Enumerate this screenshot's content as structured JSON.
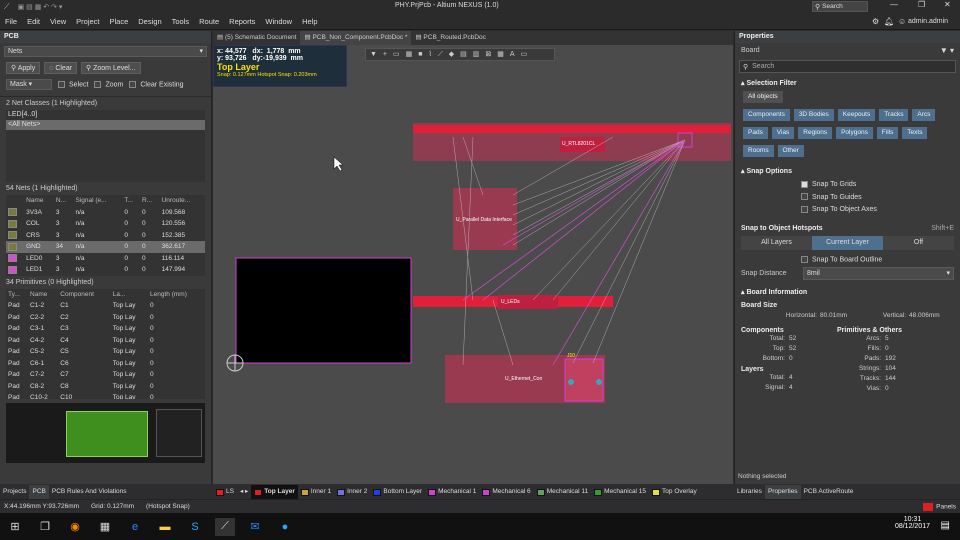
{
  "titlebar": {
    "title": "PHY.PrjPcb - Altium NEXUS (1.0)",
    "search": "Search",
    "user": "admin.admin"
  },
  "menu": [
    "File",
    "Edit",
    "View",
    "Project",
    "Place",
    "Design",
    "Tools",
    "Route",
    "Reports",
    "Window",
    "Help"
  ],
  "left": {
    "panel_title": "PCB",
    "mode_select": "Nets",
    "apply": "Apply",
    "clear": "Clear",
    "zoom_level": "Zoom Level...",
    "mask": "Mask",
    "select": "Select",
    "zoom": "Zoom",
    "clear_existing": "Clear Existing",
    "net_classes_header": "2 Net Classes (1 Highlighted)",
    "net_classes": [
      "LED[4..0]",
      "<All Nets>"
    ],
    "nets_header": "54 Nets (1 Highlighted)",
    "nets_cols": [
      "Name",
      "N...",
      "Signal (e...",
      "T...",
      "R...",
      "Unroute..."
    ],
    "nets": [
      {
        "color": "#7a7a3a",
        "name": "3V3A",
        "n": "3",
        "sig": "n/a",
        "t": "0",
        "r": "0",
        "un": "109.568"
      },
      {
        "color": "#7a7a3a",
        "name": "COL",
        "n": "3",
        "sig": "n/a",
        "t": "0",
        "r": "0",
        "un": "120.556"
      },
      {
        "color": "#7a7a3a",
        "name": "CRS",
        "n": "3",
        "sig": "n/a",
        "t": "0",
        "r": "0",
        "un": "152.385"
      },
      {
        "color": "#7a7a3a",
        "name": "GND",
        "n": "34",
        "sig": "n/a",
        "t": "0",
        "r": "0",
        "un": "362.617"
      },
      {
        "color": "#d050d0",
        "name": "LED0",
        "n": "3",
        "sig": "n/a",
        "t": "0",
        "r": "0",
        "un": "116.114"
      },
      {
        "color": "#d050d0",
        "name": "LED1",
        "n": "3",
        "sig": "n/a",
        "t": "0",
        "r": "0",
        "un": "147.994"
      }
    ],
    "prims_header": "34 Primitives (0 Highlighted)",
    "prims_cols": [
      "Ty...",
      "Name",
      "Component",
      "La...",
      "Length (mm)"
    ],
    "prims": [
      {
        "t": "Pad",
        "n": "C1-2",
        "c": "C1",
        "l": "Top Lay",
        "len": "0"
      },
      {
        "t": "Pad",
        "n": "C2-2",
        "c": "C2",
        "l": "Top Lay",
        "len": "0"
      },
      {
        "t": "Pad",
        "n": "C3-1",
        "c": "C3",
        "l": "Top Lay",
        "len": "0"
      },
      {
        "t": "Pad",
        "n": "C4-2",
        "c": "C4",
        "l": "Top Lay",
        "len": "0"
      },
      {
        "t": "Pad",
        "n": "C5-2",
        "c": "C5",
        "l": "Top Lay",
        "len": "0"
      },
      {
        "t": "Pad",
        "n": "C6-1",
        "c": "C6",
        "l": "Top Lay",
        "len": "0"
      },
      {
        "t": "Pad",
        "n": "C7-2",
        "c": "C7",
        "l": "Top Lay",
        "len": "0"
      },
      {
        "t": "Pad",
        "n": "C8-2",
        "c": "C8",
        "l": "Top Lay",
        "len": "0"
      },
      {
        "t": "Pad",
        "n": "C10-2",
        "c": "C10",
        "l": "Top Lay",
        "len": "0"
      }
    ],
    "bottom_tabs": [
      "Projects",
      "PCB",
      "PCB Rules And Violations"
    ]
  },
  "doctabs": [
    "(5) Schematic Document",
    "PCB_Non_Component.PcbDoc *",
    "PCB_Routed.PcbDoc"
  ],
  "hud": {
    "line1": "x: 44,577   dx:  1,778  mm",
    "line2": "y: 93,726   dy:-19,939  mm",
    "layer": "Top Layer",
    "snap": "Snap: 0.127mm Hotspot Snap: 0.203mm"
  },
  "pcb_labels": {
    "u1": "U_RTL8201CL",
    "u2": "U_Parallel Data Interface",
    "u3": "U_LEDs",
    "u4": "U_Ethernet_Con",
    "u5": "J10"
  },
  "right": {
    "title": "Properties",
    "board": "Board",
    "search": "Search",
    "sel_filter": "Selection Filter",
    "filter_all": "All objects",
    "filters": [
      "Components",
      "3D Bodies",
      "Keepouts",
      "Tracks",
      "Arcs",
      "Pads",
      "Vias",
      "Regions",
      "Polygons",
      "Fills",
      "Texts",
      "Rooms",
      "Other"
    ],
    "snap_options": "Snap Options",
    "snap_checks": [
      "Snap To Grids",
      "Snap To Guides",
      "Snap To Object Axes"
    ],
    "snap_hotspots": "Snap to Object Hotspots",
    "shortcut": "Shift+E",
    "hot_tabs": [
      "All Layers",
      "Current Layer",
      "Off"
    ],
    "snap_outline": "Snap To Board Outline",
    "snap_distance_label": "Snap Distance",
    "snap_distance": "8mil",
    "board_info": "Board Information",
    "board_size": "Board Size",
    "horizontal_label": "Horizontal:",
    "horizontal": "80.01mm",
    "vertical_label": "Vertical:",
    "vertical": "48.006mm",
    "components": "Components",
    "prims_others": "Primitives & Others",
    "comp_rows": [
      [
        "Total:",
        "52"
      ],
      [
        "Top:",
        "52"
      ],
      [
        "Bottom:",
        "0"
      ]
    ],
    "prim_rows": [
      [
        "Arcs:",
        "5"
      ],
      [
        "Fills:",
        "0"
      ],
      [
        "Pads:",
        "192"
      ],
      [
        "Strings:",
        "104"
      ],
      [
        "Tracks:",
        "144"
      ],
      [
        "Vias:",
        "0"
      ]
    ],
    "layers": "Layers",
    "layer_rows": [
      [
        "Total:",
        "4"
      ],
      [
        "Signal:",
        "4"
      ]
    ],
    "nothing": "Nothing selected",
    "bottom_tabs": [
      "Libraries",
      "Properties",
      "PCB ActiveRoute"
    ]
  },
  "layerbar": {
    "ls": "LS",
    "layers": [
      {
        "name": "Top Layer",
        "color": "#e02020"
      },
      {
        "name": "Inner 1",
        "color": "#c8a040"
      },
      {
        "name": "Inner 2",
        "color": "#7070e0"
      },
      {
        "name": "Bottom Layer",
        "color": "#2040e0"
      },
      {
        "name": "Mechanical 1",
        "color": "#d040d0"
      },
      {
        "name": "Mechanical 6",
        "color": "#d040d0"
      },
      {
        "name": "Mechanical 11",
        "color": "#60a060"
      },
      {
        "name": "Mechanical 15",
        "color": "#30a030"
      },
      {
        "name": "Top Overlay",
        "color": "#e0e040"
      }
    ]
  },
  "status": {
    "coords": "X:44.196mm Y:93.726mm",
    "grid": "Grid: 0.127mm",
    "snap": "(Hotspot Snap)",
    "panels": "Panels"
  },
  "taskbar": {
    "time": "10:31",
    "date": "08/12/2017"
  }
}
